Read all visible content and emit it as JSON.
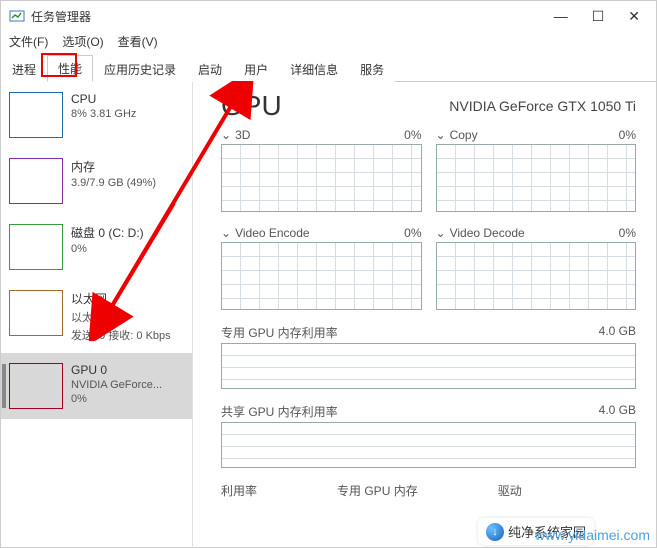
{
  "window": {
    "title": "任务管理器",
    "min": "—",
    "max": "☐",
    "close": "✕"
  },
  "menu": {
    "file": "文件(F)",
    "options": "选项(O)",
    "view": "查看(V)"
  },
  "tabs": {
    "processes": "进程",
    "performance": "性能",
    "apphistory": "应用历史记录",
    "startup": "启动",
    "users": "用户",
    "details": "详细信息",
    "services": "服务"
  },
  "sidebar": {
    "cpu": {
      "title": "CPU",
      "line": "8%  3.81 GHz"
    },
    "mem": {
      "title": "内存",
      "line": "3.9/7.9 GB (49%)"
    },
    "disk": {
      "title": "磁盘 0 (C: D:)",
      "line": "0%"
    },
    "eth": {
      "title": "以太网",
      "sub": "以太网",
      "line": "发送: 0 接收: 0 Kbps"
    },
    "gpu": {
      "title": "GPU 0",
      "sub": "NVIDIA GeForce...",
      "line": "0%"
    }
  },
  "main": {
    "title": "GPU",
    "device": "NVIDIA GeForce GTX 1050 Ti",
    "charts": {
      "c3d": {
        "label": "3D",
        "pct": "0%"
      },
      "copy": {
        "label": "Copy",
        "pct": "0%"
      },
      "venc": {
        "label": "Video Encode",
        "pct": "0%"
      },
      "vdec": {
        "label": "Video Decode",
        "pct": "0%"
      }
    },
    "dedmem": {
      "label": "专用 GPU 内存利用率",
      "cap": "4.0 GB"
    },
    "shrmem": {
      "label": "共享 GPU 内存利用率",
      "cap": "4.0 GB"
    },
    "bottom": {
      "util": "利用率",
      "ded": "专用 GPU 内存",
      "drv": "驱动"
    }
  },
  "branding": {
    "logo": "纯净系统家园",
    "watermark": "www.yidaimei.com",
    "arrow": "↓"
  },
  "chevron": "⌄"
}
